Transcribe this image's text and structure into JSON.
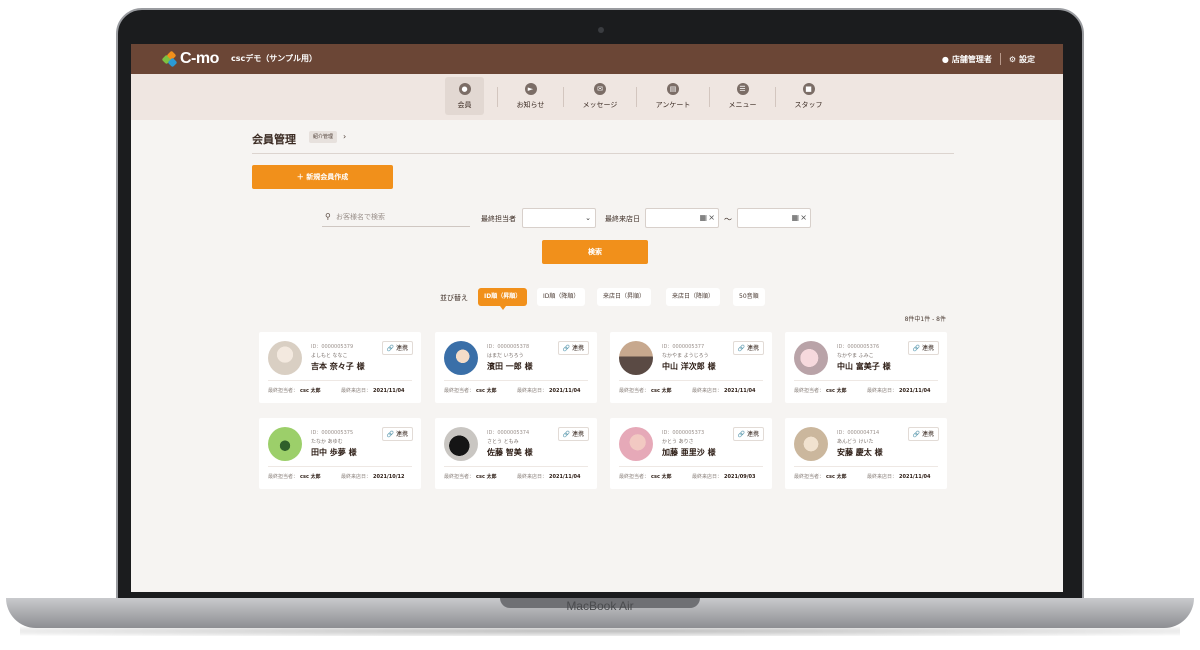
{
  "device_label": "MacBook Air",
  "header": {
    "logo_text": "C-mo",
    "app_name": "cscデモ（サンプル用）",
    "user_label": "店舗管理者",
    "settings_label": "設定"
  },
  "tabs": [
    {
      "label": "会員",
      "icon": "person-icon",
      "active": true
    },
    {
      "label": "お知らせ",
      "icon": "megaphone-icon",
      "active": false
    },
    {
      "label": "メッセージ",
      "icon": "envelope-icon",
      "active": false
    },
    {
      "label": "アンケート",
      "icon": "clipboard-icon",
      "active": false
    },
    {
      "label": "メニュー",
      "icon": "list-icon",
      "active": false
    },
    {
      "label": "スタッフ",
      "icon": "briefcase-icon",
      "active": false
    }
  ],
  "page": {
    "title": "会員管理",
    "crumb_button": "紹介管理",
    "new_member_button": "＋ 新規会員作成"
  },
  "filters": {
    "search_placeholder": "お客様名で検索",
    "staff_label": "最終担当者",
    "staff_value": "",
    "visit_label": "最終来店日",
    "date_from": "",
    "date_to": "",
    "range_sep": "～",
    "search_button": "検索"
  },
  "sort": {
    "label": "並び替え",
    "options": [
      {
        "label": "ID順（昇順）",
        "active": true
      },
      {
        "label": "ID順（降順）",
        "active": false
      },
      {
        "label": "来店日（昇順）",
        "active": false
      },
      {
        "label": "来店日（降順）",
        "active": false
      },
      {
        "label": "50音順",
        "active": false
      }
    ],
    "count_text": "8件中1件 - 8件"
  },
  "member_labels": {
    "link_button": "連携",
    "last_staff": "最終担当者：",
    "last_visit": "最終来店日："
  },
  "members": [
    {
      "id": "ID：0000005379",
      "kana": "よしもと ななこ",
      "name": "吉本 奈々子 様",
      "staff": "csc 太郎",
      "visit": "2021/11/04"
    },
    {
      "id": "ID：0000005378",
      "kana": "はまだ いちろう",
      "name": "濱田 一郎 様",
      "staff": "csc 太郎",
      "visit": "2021/11/04"
    },
    {
      "id": "ID：0000005377",
      "kana": "なかやま ようじろう",
      "name": "中山 洋次郎 様",
      "staff": "csc 太郎",
      "visit": "2021/11/04"
    },
    {
      "id": "ID：0000005376",
      "kana": "なかやま ふみこ",
      "name": "中山 富美子 様",
      "staff": "csc 太郎",
      "visit": "2021/11/04"
    },
    {
      "id": "ID：0000005375",
      "kana": "たなか あゆむ",
      "name": "田中 歩夢 様",
      "staff": "csc 太郎",
      "visit": "2021/10/12"
    },
    {
      "id": "ID：0000005374",
      "kana": "さとう ともみ",
      "name": "佐藤 智美 様",
      "staff": "csc 太郎",
      "visit": "2021/11/04"
    },
    {
      "id": "ID：0000005373",
      "kana": "かとう ありさ",
      "name": "加藤 亜里沙 様",
      "staff": "csc 太郎",
      "visit": "2021/09/03"
    },
    {
      "id": "ID：0000004714",
      "kana": "あんどう けいた",
      "name": "安藤 慶太 様",
      "staff": "csc 太郎",
      "visit": "2021/11/04"
    }
  ],
  "colors": {
    "header_bg": "#6b4636",
    "accent": "#f1901b",
    "nav_bg": "#efe6e1",
    "page_bg": "#f6f4f2"
  }
}
